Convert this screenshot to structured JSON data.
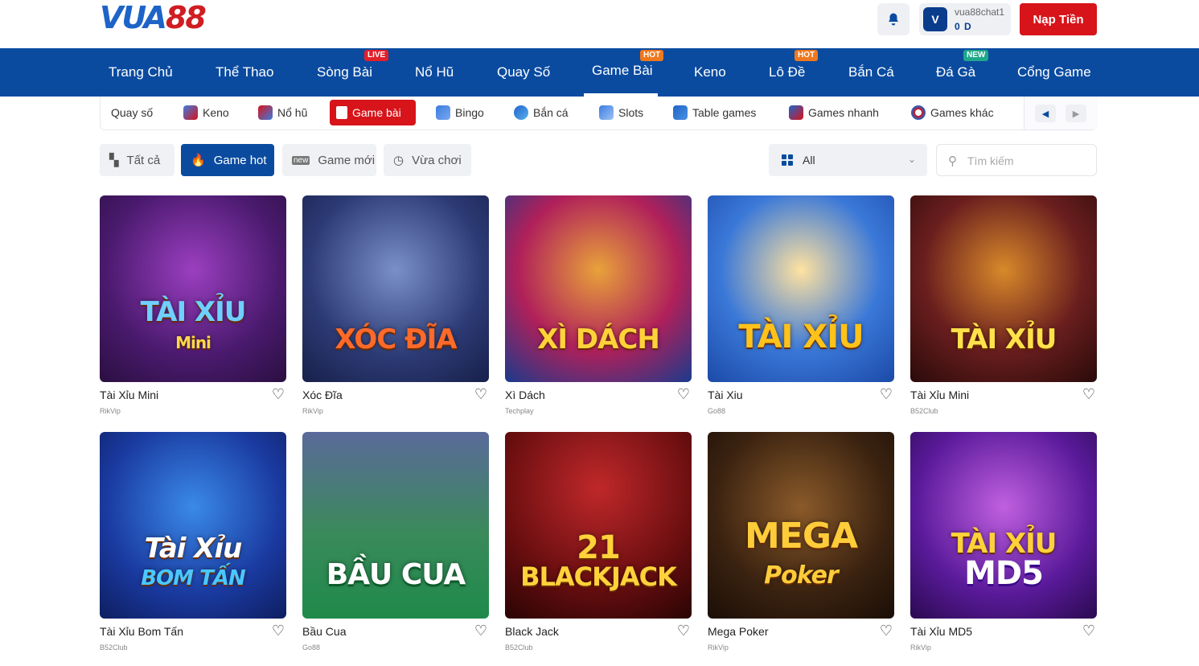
{
  "brand": {
    "logo_part1": "VUA",
    "logo_part2": "88"
  },
  "header": {
    "username": "vua88chat1",
    "balance": "0 D",
    "avatar_letter": "V",
    "deposit_label": "Nạp Tiền"
  },
  "main_nav": [
    {
      "label": "Trang Chủ"
    },
    {
      "label": "Thể Thao"
    },
    {
      "label": "Sòng Bài",
      "badge": "LIVE"
    },
    {
      "label": "Nổ Hũ"
    },
    {
      "label": "Quay Số"
    },
    {
      "label": "Game Bài",
      "badge": "HOT",
      "active": true
    },
    {
      "label": "Keno"
    },
    {
      "label": "Lô Đề",
      "badge": "HOT"
    },
    {
      "label": "Bắn Cá"
    },
    {
      "label": "Đá Gà",
      "badge": "NEW"
    },
    {
      "label": "Cổng Game"
    }
  ],
  "sub_nav": [
    {
      "label": "Quay số"
    },
    {
      "label": "Keno"
    },
    {
      "label": "Nổ hũ"
    },
    {
      "label": "Game bài",
      "active": true
    },
    {
      "label": "Bingo"
    },
    {
      "label": "Bắn cá"
    },
    {
      "label": "Slots"
    },
    {
      "label": "Table games"
    },
    {
      "label": "Games nhanh"
    },
    {
      "label": "Games khác"
    }
  ],
  "filters": [
    {
      "label": "Tất cả"
    },
    {
      "label": "Game hot",
      "active": true
    },
    {
      "label": "Game mới"
    },
    {
      "label": "Vừa chơi"
    }
  ],
  "category_select": {
    "value": "All"
  },
  "search": {
    "placeholder": "Tìm kiếm"
  },
  "games": [
    {
      "name": "Tài Xỉu Mini",
      "provider": "RikVip",
      "art_text": "TÀI XỈU",
      "art_sub": "Mini"
    },
    {
      "name": "Xóc Đĩa",
      "provider": "RikVip",
      "art_text": "XÓC ĐĨA",
      "art_sub": ""
    },
    {
      "name": "Xì Dách",
      "provider": "Techplay",
      "art_text": "XÌ DÁCH",
      "art_sub": ""
    },
    {
      "name": "Tài Xiu",
      "provider": "Go88",
      "art_text": "TÀI XỈU",
      "art_sub": ""
    },
    {
      "name": "Tài Xỉu Mini",
      "provider": "B52Club",
      "art_text": "TÀI XỈU",
      "art_sub": ""
    },
    {
      "name": "Tài Xỉu Bom Tấn",
      "provider": "B52Club",
      "art_text": "Tài Xỉu",
      "art_sub": "BOM TẤN"
    },
    {
      "name": "Bầu Cua",
      "provider": "Go88",
      "art_text": "BẦU CUA",
      "art_sub": ""
    },
    {
      "name": "Black Jack",
      "provider": "B52Club",
      "art_text": "BLACKJACK",
      "art_sub": "21"
    },
    {
      "name": "Mega Poker",
      "provider": "RikVip",
      "art_text": "MEGA",
      "art_sub": "Poker"
    },
    {
      "name": "Tài Xỉu MD5",
      "provider": "RikVip",
      "art_text": "TÀI XỈU",
      "art_sub": "MD5"
    }
  ],
  "colors": {
    "primary": "#0a4ba0",
    "accent_red": "#d7141a"
  }
}
